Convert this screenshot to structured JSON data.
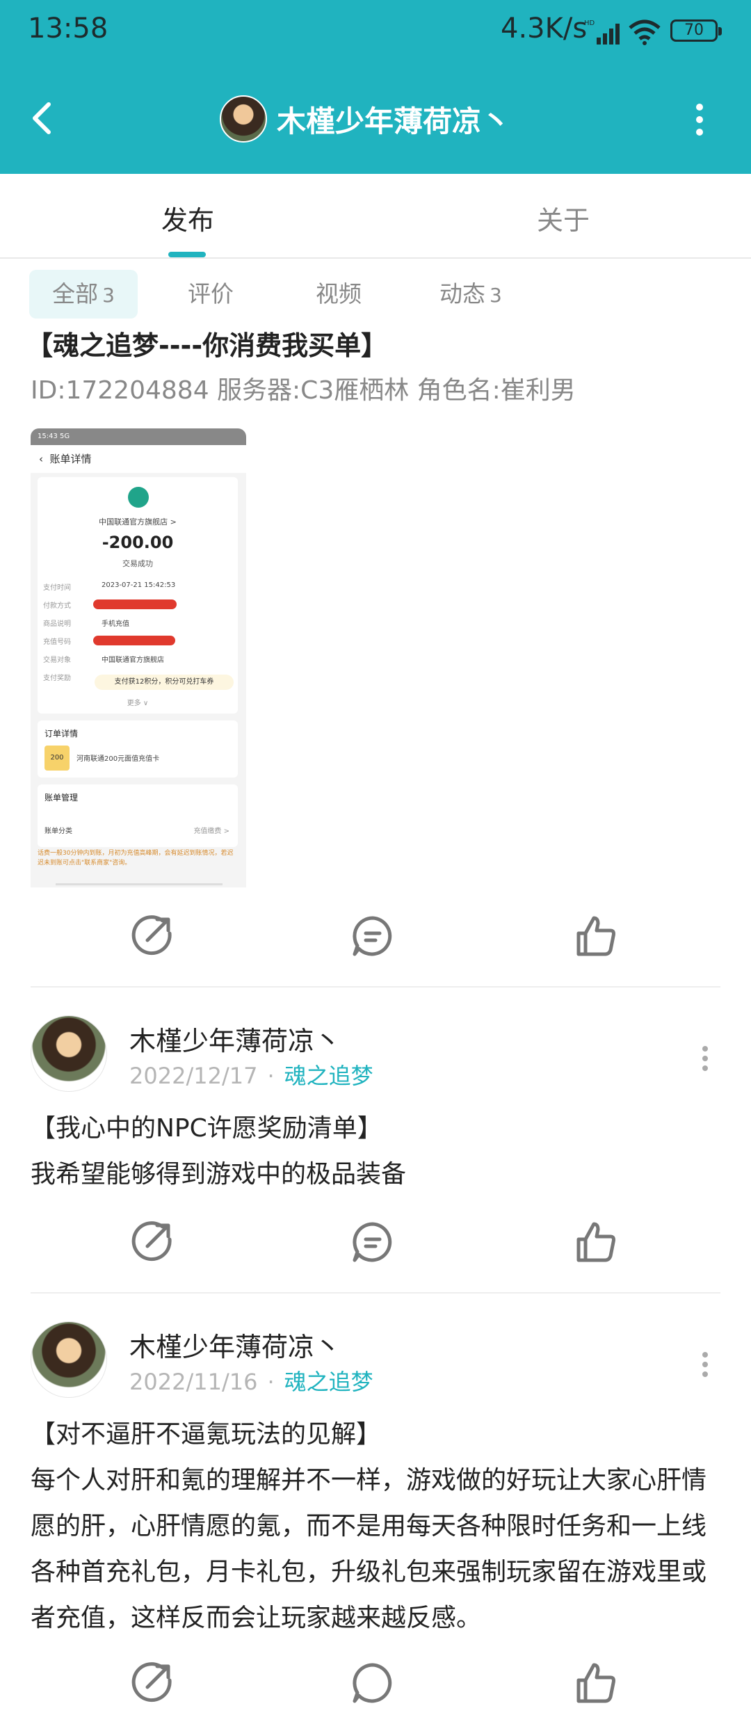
{
  "status_bar": {
    "time": "13:58",
    "net_speed": "4.3K/s",
    "battery": "70"
  },
  "nav": {
    "title": "木槿少年薄荷凉丶"
  },
  "tabs": [
    {
      "label": "发布"
    },
    {
      "label": "关于"
    }
  ],
  "filters": [
    {
      "label": "全部",
      "count": "3"
    },
    {
      "label": "评价",
      "count": ""
    },
    {
      "label": "视频",
      "count": ""
    },
    {
      "label": "动态",
      "count": "3"
    }
  ],
  "post1": {
    "title": "【魂之追梦----你消费我买单】",
    "subtitle": "ID:172204884 服务器:C3雁栖林 角色名:崔利男",
    "screenshot": {
      "status": "15:43 5G",
      "header": "账单详情",
      "store": "中国联通官方旗舰店 >",
      "amount": "-200.00",
      "status_text": "交易成功",
      "rows": [
        {
          "label": "支付时间",
          "value": "2023-07-21 15:42:53"
        },
        {
          "label": "付款方式",
          "value": ""
        },
        {
          "label": "商品说明",
          "value": "手机充值"
        },
        {
          "label": "充值号码",
          "value": ""
        },
        {
          "label": "交易对象",
          "value": "中国联通官方旗舰店"
        },
        {
          "label": "支付奖励",
          "value": ""
        }
      ],
      "perk": "支付获12积分，积分可兑打车券",
      "more": "更多 ∨",
      "order_title": "订单详情",
      "order_item": "河南联通200元面值充值卡",
      "gift_label": "200",
      "mgmt_title": "账单管理",
      "mgmt_left": "账单分类",
      "mgmt_right": "充值缴费 >",
      "note": "话费一般30分钟内到账，月初为充值高峰期，会有延迟到账情况，若迟迟未到账可点击\"联系商家\"咨询。"
    }
  },
  "posts": [
    {
      "author": "木槿少年薄荷凉丶",
      "date": "2022/12/17",
      "circle": "魂之追梦",
      "title": "【我心中的NPC许愿奖励清单】",
      "body": "我希望能够得到游戏中的极品装备"
    },
    {
      "author": "木槿少年薄荷凉丶",
      "date": "2022/11/16",
      "circle": "魂之追梦",
      "title": "【对不逼肝不逼氪玩法的见解】",
      "body": "每个人对肝和氪的理解并不一样，游戏做的好玩让大家心肝情愿的肝，心肝情愿的氪，而不是用每天各种限时任务和一上线各种首充礼包，月卡礼包，升级礼包来强制玩家留在游戏里或者充值，这样反而会让玩家越来越反感。"
    }
  ],
  "colors": {
    "accent": "#20b3bf",
    "redaction": "#e0392d"
  },
  "icons": [
    "back-icon",
    "more-vertical-icon",
    "share-icon",
    "comment-icon",
    "like-icon"
  ]
}
